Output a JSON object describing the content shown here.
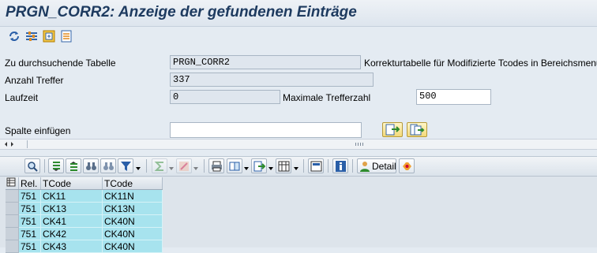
{
  "page_title": "PRGN_CORR2: Anzeige der gefundenen Einträge",
  "colors": {
    "title": "#1d3a5f",
    "row_bg": "#a7e3ee",
    "button_yellow": "#f3d979"
  },
  "toolbar_icons": [
    "refresh-icon",
    "settings-icon",
    "export-icon",
    "list-icon"
  ],
  "form": {
    "table_label": "Zu durchsuchende Tabelle",
    "table_value": "PRGN_CORR2",
    "table_desc": "Korrekturtabelle für Modifizierte Tcodes in Bereichsmenüs",
    "hits_label": "Anzahl Treffer",
    "hits_value": "337",
    "runtime_label": "Laufzeit",
    "runtime_value": "0",
    "maxhits_label": "Maximale Trefferzahl",
    "maxhits_value": "500",
    "insert_label": "Spalte einfügen",
    "insert_value": ""
  },
  "grid": {
    "detail_label": "Detail",
    "headers": [
      "Rel.",
      "TCode",
      "TCode"
    ],
    "rows": [
      [
        "751",
        "CK11",
        "CK11N"
      ],
      [
        "751",
        "CK13",
        "CK13N"
      ],
      [
        "751",
        "CK41",
        "CK40N"
      ],
      [
        "751",
        "CK42",
        "CK40N"
      ],
      [
        "751",
        "CK43",
        "CK40N"
      ]
    ]
  }
}
